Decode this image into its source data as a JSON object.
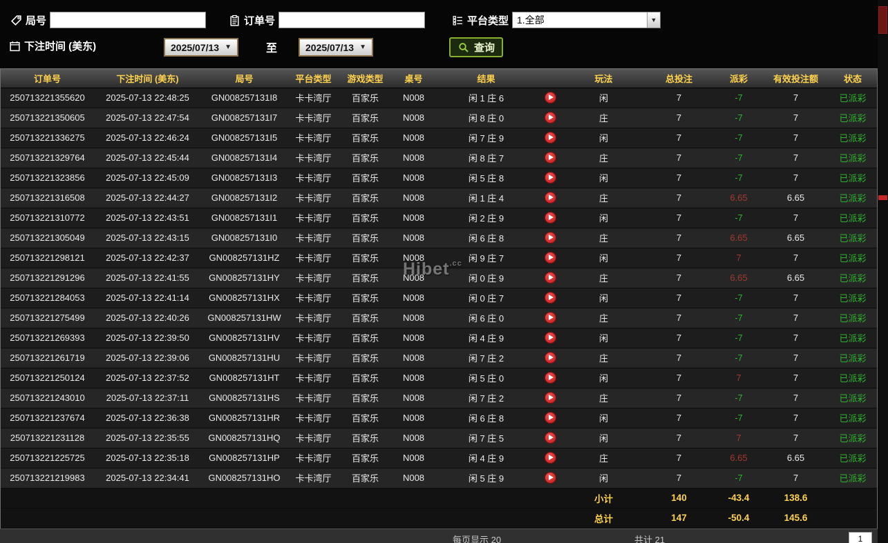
{
  "colors": {
    "yellow": "#ffd24d",
    "green": "#2db32d",
    "red": "#a5392e"
  },
  "filters": {
    "game_no_label": "局号",
    "order_no_label": "订单号",
    "platform_label": "平台类型",
    "platform_value": "1.全部",
    "bet_time_label": "下注时间 (美东)",
    "date_from": "2025/07/13",
    "to_label": "至",
    "date_to": "2025/07/13",
    "search_label": "查询"
  },
  "table": {
    "headers": [
      "订单号",
      "下注时间 (美东)",
      "局号",
      "平台类型",
      "游戏类型",
      "桌号",
      "结果",
      "",
      "玩法",
      "总投注",
      "派彩",
      "有效投注额",
      "状态"
    ],
    "rows": [
      {
        "order_no": "250713221355620",
        "bet_time": "2025-07-13 22:48:25",
        "game_no": "GN008257131I8",
        "platform": "卡卡湾厅",
        "game_type": "百家乐",
        "table_no": "N008",
        "result": "闲 1 庄 6",
        "play": "闲",
        "total_bet": "7",
        "payout": "-7",
        "payout_color": "green",
        "valid_bet": "7",
        "status": "已派彩"
      },
      {
        "order_no": "250713221350605",
        "bet_time": "2025-07-13 22:47:54",
        "game_no": "GN008257131I7",
        "platform": "卡卡湾厅",
        "game_type": "百家乐",
        "table_no": "N008",
        "result": "闲 8 庄 0",
        "play": "庄",
        "total_bet": "7",
        "payout": "-7",
        "payout_color": "green",
        "valid_bet": "7",
        "status": "已派彩"
      },
      {
        "order_no": "250713221336275",
        "bet_time": "2025-07-13 22:46:24",
        "game_no": "GN008257131I5",
        "platform": "卡卡湾厅",
        "game_type": "百家乐",
        "table_no": "N008",
        "result": "闲 7 庄 9",
        "play": "闲",
        "total_bet": "7",
        "payout": "-7",
        "payout_color": "green",
        "valid_bet": "7",
        "status": "已派彩"
      },
      {
        "order_no": "250713221329764",
        "bet_time": "2025-07-13 22:45:44",
        "game_no": "GN008257131I4",
        "platform": "卡卡湾厅",
        "game_type": "百家乐",
        "table_no": "N008",
        "result": "闲 8 庄 7",
        "play": "庄",
        "total_bet": "7",
        "payout": "-7",
        "payout_color": "green",
        "valid_bet": "7",
        "status": "已派彩"
      },
      {
        "order_no": "250713221323856",
        "bet_time": "2025-07-13 22:45:09",
        "game_no": "GN008257131I3",
        "platform": "卡卡湾厅",
        "game_type": "百家乐",
        "table_no": "N008",
        "result": "闲 5 庄 8",
        "play": "闲",
        "total_bet": "7",
        "payout": "-7",
        "payout_color": "green",
        "valid_bet": "7",
        "status": "已派彩"
      },
      {
        "order_no": "250713221316508",
        "bet_time": "2025-07-13 22:44:27",
        "game_no": "GN008257131I2",
        "platform": "卡卡湾厅",
        "game_type": "百家乐",
        "table_no": "N008",
        "result": "闲 1 庄 4",
        "play": "庄",
        "total_bet": "7",
        "payout": "6.65",
        "payout_color": "red",
        "valid_bet": "6.65",
        "status": "已派彩"
      },
      {
        "order_no": "250713221310772",
        "bet_time": "2025-07-13 22:43:51",
        "game_no": "GN008257131I1",
        "platform": "卡卡湾厅",
        "game_type": "百家乐",
        "table_no": "N008",
        "result": "闲 2 庄 9",
        "play": "闲",
        "total_bet": "7",
        "payout": "-7",
        "payout_color": "green",
        "valid_bet": "7",
        "status": "已派彩"
      },
      {
        "order_no": "250713221305049",
        "bet_time": "2025-07-13 22:43:15",
        "game_no": "GN008257131I0",
        "platform": "卡卡湾厅",
        "game_type": "百家乐",
        "table_no": "N008",
        "result": "闲 6 庄 8",
        "play": "庄",
        "total_bet": "7",
        "payout": "6.65",
        "payout_color": "red",
        "valid_bet": "6.65",
        "status": "已派彩"
      },
      {
        "order_no": "250713221298121",
        "bet_time": "2025-07-13 22:42:37",
        "game_no": "GN008257131HZ",
        "platform": "卡卡湾厅",
        "game_type": "百家乐",
        "table_no": "N008",
        "result": "闲 9 庄 7",
        "play": "闲",
        "total_bet": "7",
        "payout": "7",
        "payout_color": "red",
        "valid_bet": "7",
        "status": "已派彩"
      },
      {
        "order_no": "250713221291296",
        "bet_time": "2025-07-13 22:41:55",
        "game_no": "GN008257131HY",
        "platform": "卡卡湾厅",
        "game_type": "百家乐",
        "table_no": "N008",
        "result": "闲 0 庄 9",
        "play": "庄",
        "total_bet": "7",
        "payout": "6.65",
        "payout_color": "red",
        "valid_bet": "6.65",
        "status": "已派彩"
      },
      {
        "order_no": "250713221284053",
        "bet_time": "2025-07-13 22:41:14",
        "game_no": "GN008257131HX",
        "platform": "卡卡湾厅",
        "game_type": "百家乐",
        "table_no": "N008",
        "result": "闲 0 庄 7",
        "play": "闲",
        "total_bet": "7",
        "payout": "-7",
        "payout_color": "green",
        "valid_bet": "7",
        "status": "已派彩"
      },
      {
        "order_no": "250713221275499",
        "bet_time": "2025-07-13 22:40:26",
        "game_no": "GN008257131HW",
        "platform": "卡卡湾厅",
        "game_type": "百家乐",
        "table_no": "N008",
        "result": "闲 6 庄 0",
        "play": "庄",
        "total_bet": "7",
        "payout": "-7",
        "payout_color": "green",
        "valid_bet": "7",
        "status": "已派彩"
      },
      {
        "order_no": "250713221269393",
        "bet_time": "2025-07-13 22:39:50",
        "game_no": "GN008257131HV",
        "platform": "卡卡湾厅",
        "game_type": "百家乐",
        "table_no": "N008",
        "result": "闲 4 庄 9",
        "play": "闲",
        "total_bet": "7",
        "payout": "-7",
        "payout_color": "green",
        "valid_bet": "7",
        "status": "已派彩"
      },
      {
        "order_no": "250713221261719",
        "bet_time": "2025-07-13 22:39:06",
        "game_no": "GN008257131HU",
        "platform": "卡卡湾厅",
        "game_type": "百家乐",
        "table_no": "N008",
        "result": "闲 7 庄 2",
        "play": "庄",
        "total_bet": "7",
        "payout": "-7",
        "payout_color": "green",
        "valid_bet": "7",
        "status": "已派彩"
      },
      {
        "order_no": "250713221250124",
        "bet_time": "2025-07-13 22:37:52",
        "game_no": "GN008257131HT",
        "platform": "卡卡湾厅",
        "game_type": "百家乐",
        "table_no": "N008",
        "result": "闲 5 庄 0",
        "play": "闲",
        "total_bet": "7",
        "payout": "7",
        "payout_color": "red",
        "valid_bet": "7",
        "status": "已派彩"
      },
      {
        "order_no": "250713221243010",
        "bet_time": "2025-07-13 22:37:11",
        "game_no": "GN008257131HS",
        "platform": "卡卡湾厅",
        "game_type": "百家乐",
        "table_no": "N008",
        "result": "闲 7 庄 2",
        "play": "庄",
        "total_bet": "7",
        "payout": "-7",
        "payout_color": "green",
        "valid_bet": "7",
        "status": "已派彩"
      },
      {
        "order_no": "250713221237674",
        "bet_time": "2025-07-13 22:36:38",
        "game_no": "GN008257131HR",
        "platform": "卡卡湾厅",
        "game_type": "百家乐",
        "table_no": "N008",
        "result": "闲 6 庄 8",
        "play": "闲",
        "total_bet": "7",
        "payout": "-7",
        "payout_color": "green",
        "valid_bet": "7",
        "status": "已派彩"
      },
      {
        "order_no": "250713221231128",
        "bet_time": "2025-07-13 22:35:55",
        "game_no": "GN008257131HQ",
        "platform": "卡卡湾厅",
        "game_type": "百家乐",
        "table_no": "N008",
        "result": "闲 7 庄 5",
        "play": "闲",
        "total_bet": "7",
        "payout": "7",
        "payout_color": "red",
        "valid_bet": "7",
        "status": "已派彩"
      },
      {
        "order_no": "250713221225725",
        "bet_time": "2025-07-13 22:35:18",
        "game_no": "GN008257131HP",
        "platform": "卡卡湾厅",
        "game_type": "百家乐",
        "table_no": "N008",
        "result": "闲 4 庄 9",
        "play": "庄",
        "total_bet": "7",
        "payout": "6.65",
        "payout_color": "red",
        "valid_bet": "6.65",
        "status": "已派彩"
      },
      {
        "order_no": "250713221219983",
        "bet_time": "2025-07-13 22:34:41",
        "game_no": "GN008257131HO",
        "platform": "卡卡湾厅",
        "game_type": "百家乐",
        "table_no": "N008",
        "result": "闲 5 庄 9",
        "play": "闲",
        "total_bet": "7",
        "payout": "-7",
        "payout_color": "green",
        "valid_bet": "7",
        "status": "已派彩"
      }
    ],
    "subtotal": {
      "label": "小计",
      "total_bet": "140",
      "payout": "-43.4",
      "valid_bet": "138.6"
    },
    "total": {
      "label": "总计",
      "total_bet": "147",
      "payout": "-50.4",
      "valid_bet": "145.6"
    }
  },
  "footer": {
    "per_page_label": "每页显示",
    "per_page_value": "20",
    "total_count_label": "共计",
    "total_count_value": "21",
    "page_value": "1"
  },
  "watermark": {
    "main": "Hibet",
    "suffix": ".cc"
  }
}
